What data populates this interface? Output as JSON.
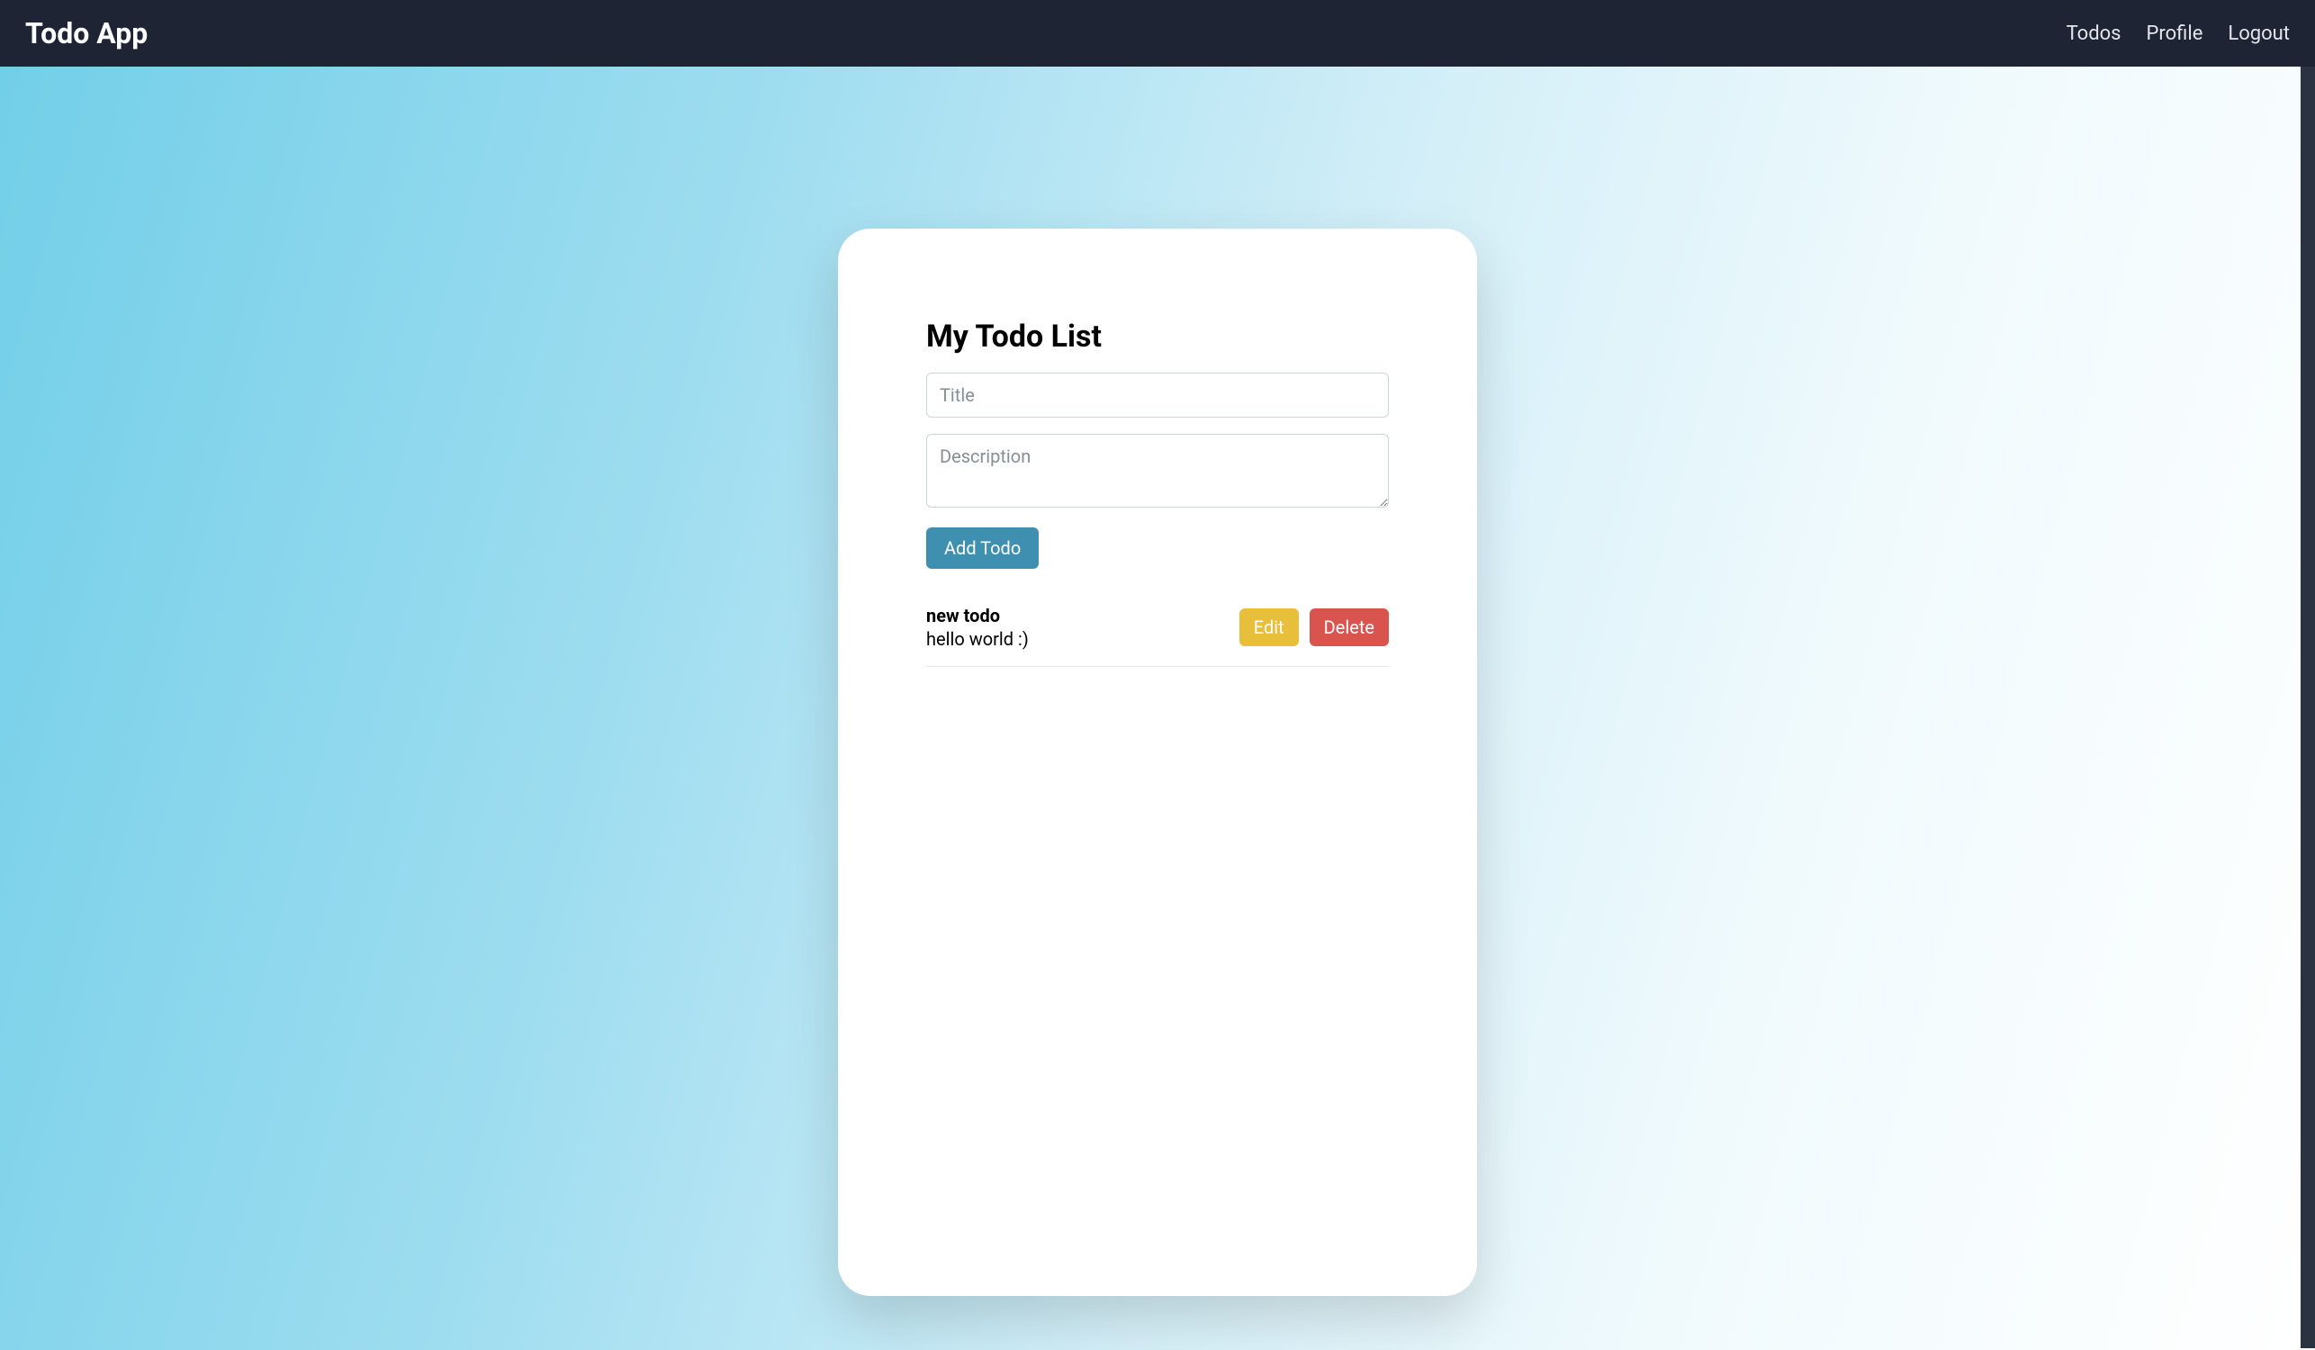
{
  "navbar": {
    "brand": "Todo App",
    "links": {
      "todos": "Todos",
      "profile": "Profile",
      "logout": "Logout"
    }
  },
  "card": {
    "title": "My Todo List"
  },
  "form": {
    "title_placeholder": "Title",
    "description_placeholder": "Description",
    "submit_label": "Add Todo"
  },
  "todos": [
    {
      "title": "new todo",
      "description": "hello world :)"
    }
  ],
  "actions": {
    "edit_label": "Edit",
    "delete_label": "Delete"
  }
}
